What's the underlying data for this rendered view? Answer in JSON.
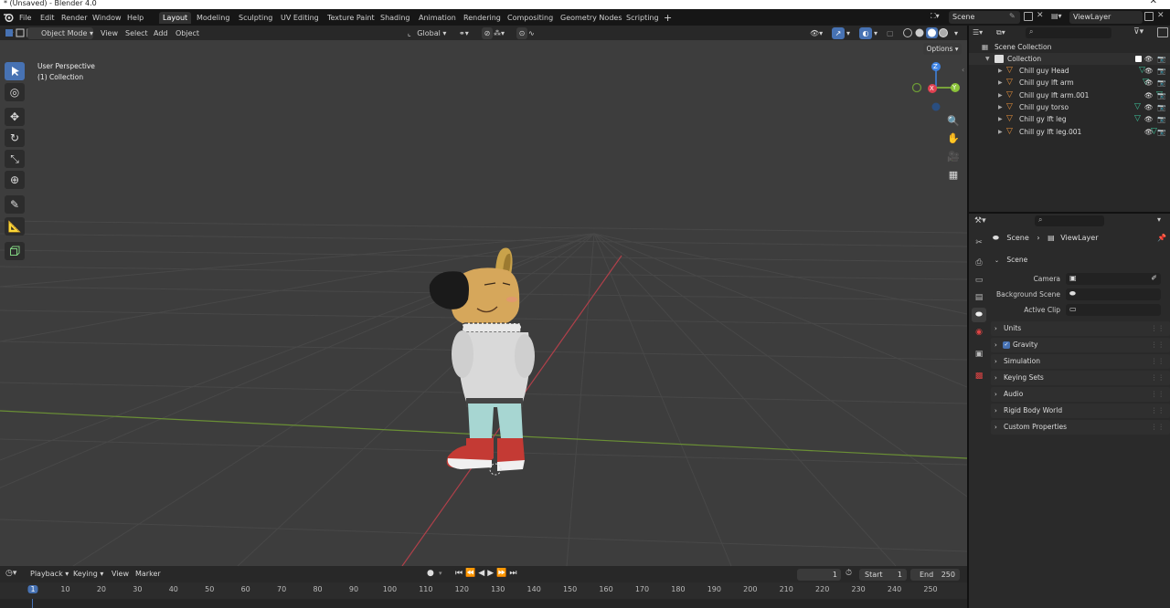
{
  "window": {
    "title": "* (Unsaved) - Blender 4.0",
    "close": "✕"
  },
  "menus": [
    "File",
    "Edit",
    "Render",
    "Window",
    "Help"
  ],
  "workspaces": [
    "Layout",
    "Modeling",
    "Sculpting",
    "UV Editing",
    "Texture Paint",
    "Shading",
    "Animation",
    "Rendering",
    "Compositing",
    "Geometry Nodes",
    "Scripting"
  ],
  "add_workspace": "+",
  "scene_field": "Scene",
  "viewlayer_field": "ViewLayer",
  "viewport_header": {
    "mode": "Object Mode",
    "menus": [
      "View",
      "Select",
      "Add",
      "Object"
    ],
    "transform_orientation": "Global",
    "options": "Options"
  },
  "viewport": {
    "overlay_line1": "User Perspective",
    "overlay_line2": "(1) Collection",
    "gizmo": {
      "z": "Z",
      "x": "X",
      "y": "Y"
    }
  },
  "outliner": {
    "root": "Scene Collection",
    "collection": "Collection",
    "items": [
      "Chill guy Head",
      "Chill guy lft arm",
      "Chill guy lft arm.001",
      "Chill guy torso",
      "Chill gy lft leg",
      "Chill gy lft leg.001"
    ]
  },
  "properties": {
    "breadcrumb": [
      "Scene",
      "ViewLayer"
    ],
    "panel_title": "Scene",
    "fields": [
      "Camera",
      "Background Scene",
      "Active Clip"
    ],
    "sections": [
      "Units",
      "Gravity",
      "Simulation",
      "Keying Sets",
      "Audio",
      "Rigid Body World",
      "Custom Properties"
    ]
  },
  "timeline": {
    "menus": [
      "Playback",
      "Keying",
      "View",
      "Marker"
    ],
    "current_frame": "1",
    "start_label": "Start",
    "start_value": "1",
    "end_label": "End",
    "end_value": "250",
    "ruler": [
      "1",
      "10",
      "20",
      "30",
      "40",
      "50",
      "60",
      "70",
      "80",
      "90",
      "100",
      "110",
      "120",
      "130",
      "140",
      "150",
      "160",
      "170",
      "180",
      "190",
      "200",
      "210",
      "220",
      "230",
      "240",
      "250"
    ]
  },
  "colors": {
    "accent": "#4772b3",
    "x_axis": "#e04050",
    "y_axis": "#8cc33a",
    "z_axis": "#3f84e4",
    "background": "#3d3d3d"
  }
}
